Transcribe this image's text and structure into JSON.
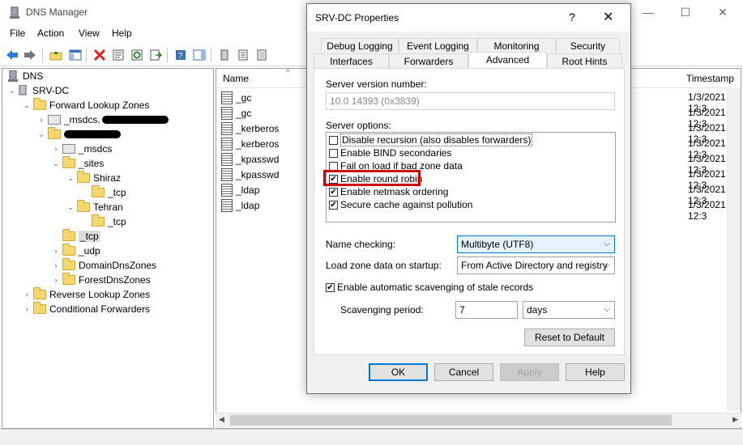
{
  "window": {
    "title": "DNS Manager",
    "controls": {
      "minimize": "—",
      "maximize": "☐",
      "close": "✕"
    }
  },
  "menu": [
    "File",
    "Action",
    "View",
    "Help"
  ],
  "tree": {
    "root": "DNS",
    "server": "SRV-DC",
    "forward_zones": "Forward Lookup Zones",
    "msdcs_zone": "_msdcs.",
    "sub_msdcs": "_msdcs",
    "sites": "_sites",
    "shiraz": "Shiraz",
    "shiraz_tcp": "_tcp",
    "tehran": "Tehran",
    "tehran_tcp": "_tcp",
    "tcp": "_tcp",
    "udp": "_udp",
    "domain_dns": "DomainDnsZones",
    "forest_dns": "ForestDnsZones",
    "reverse_zones": "Reverse Lookup Zones",
    "cond_forwarders": "Conditional Forwarders"
  },
  "list": {
    "col_name": "Name",
    "col_timestamp": "Timestamp",
    "rows": [
      {
        "name": "_gc",
        "ts": "1/3/2021 12:3"
      },
      {
        "name": "_gc",
        "ts": "1/3/2021 12:3"
      },
      {
        "name": "_kerberos",
        "ts": "1/3/2021 12:3"
      },
      {
        "name": "_kerberos",
        "ts": "1/3/2021 12:3"
      },
      {
        "name": "_kpasswd",
        "ts": "1/3/2021 12:3"
      },
      {
        "name": "_kpasswd",
        "ts": "1/3/2021 12:3"
      },
      {
        "name": "_ldap",
        "ts": "1/3/2021 12:3"
      },
      {
        "name": "_ldap",
        "ts": "1/3/2021 12:3"
      }
    ]
  },
  "dialog": {
    "title": "SRV-DC Properties",
    "help": "?",
    "close": "✕",
    "tabs_row1": [
      "Debug Logging",
      "Event Logging",
      "Monitoring",
      "Security"
    ],
    "tabs_row2": [
      "Interfaces",
      "Forwarders",
      "Advanced",
      "Root Hints"
    ],
    "active_tab": "Advanced",
    "version_label": "Server version number:",
    "version_value": "10.0 14393 (0x3839)",
    "options_label": "Server options:",
    "options": [
      {
        "label": "Disable recursion (also disables forwarders)",
        "checked": false
      },
      {
        "label": "Enable BIND secondaries",
        "checked": false
      },
      {
        "label": "Fail on load if bad zone data",
        "checked": false
      },
      {
        "label": "Enable round robin",
        "checked": true
      },
      {
        "label": "Enable netmask ordering",
        "checked": true
      },
      {
        "label": "Secure cache against pollution",
        "checked": true
      }
    ],
    "name_checking_label": "Name checking:",
    "name_checking_value": "Multibyte (UTF8)",
    "load_zone_label": "Load zone data on startup:",
    "load_zone_value": "From Active Directory and registry",
    "scavenging_label": "Enable automatic scavenging of stale records",
    "scavenging_checked": true,
    "period_label": "Scavenging period:",
    "period_value": "7",
    "period_unit": "days",
    "reset_button": "Reset to Default",
    "ok_button": "OK",
    "cancel_button": "Cancel",
    "apply_button": "Apply",
    "help_button": "Help"
  },
  "colors": {
    "highlight": "#d00000",
    "accent": "#0078d7"
  }
}
